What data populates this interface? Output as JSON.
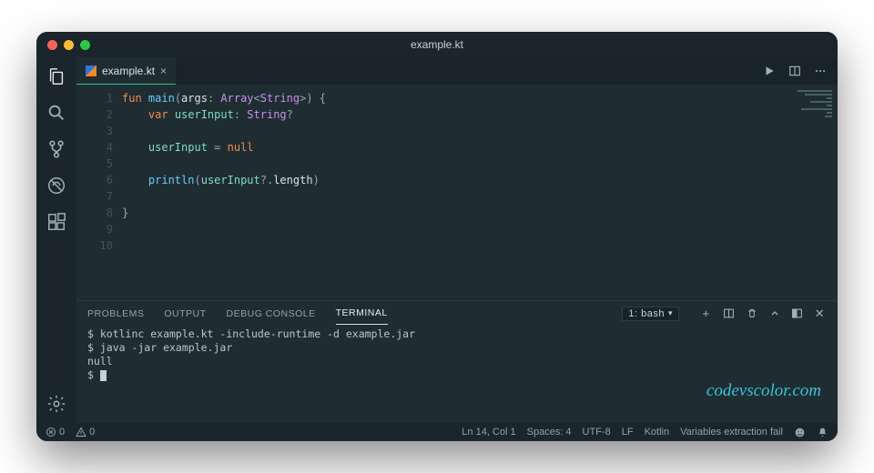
{
  "window": {
    "title": "example.kt"
  },
  "tabs": [
    {
      "label": "example.kt"
    }
  ],
  "editor": {
    "lines": [
      {
        "n": 1,
        "segs": [
          [
            "kw",
            "fun "
          ],
          [
            "fn",
            "main"
          ],
          [
            "punc",
            "("
          ],
          [
            "id",
            "args"
          ],
          [
            "punc",
            ": "
          ],
          [
            "type",
            "Array"
          ],
          [
            "punc",
            "<"
          ],
          [
            "type",
            "String"
          ],
          [
            "punc",
            ">"
          ],
          [
            "punc",
            ") {"
          ]
        ]
      },
      {
        "n": 2,
        "segs": [
          [
            "",
            "    "
          ],
          [
            "kw",
            "var "
          ],
          [
            "var",
            "userInput"
          ],
          [
            "punc",
            ": "
          ],
          [
            "type",
            "String"
          ],
          [
            "punc",
            "?"
          ]
        ]
      },
      {
        "n": 3,
        "segs": [
          [
            "",
            ""
          ]
        ]
      },
      {
        "n": 4,
        "segs": [
          [
            "",
            "    "
          ],
          [
            "var",
            "userInput"
          ],
          [
            "punc",
            " = "
          ],
          [
            "null",
            "null"
          ]
        ]
      },
      {
        "n": 5,
        "segs": [
          [
            "",
            ""
          ]
        ]
      },
      {
        "n": 6,
        "segs": [
          [
            "",
            "    "
          ],
          [
            "fn",
            "println"
          ],
          [
            "punc",
            "("
          ],
          [
            "var",
            "userInput"
          ],
          [
            "punc",
            "?."
          ],
          [
            "id",
            "length"
          ],
          [
            "punc",
            ")"
          ]
        ]
      },
      {
        "n": 7,
        "segs": [
          [
            "",
            ""
          ]
        ]
      },
      {
        "n": 8,
        "segs": [
          [
            "punc",
            "}"
          ]
        ]
      },
      {
        "n": 9,
        "segs": [
          [
            "",
            ""
          ]
        ]
      },
      {
        "n": 10,
        "segs": [
          [
            "",
            ""
          ]
        ]
      }
    ]
  },
  "panel": {
    "tabs": [
      "PROBLEMS",
      "OUTPUT",
      "DEBUG CONSOLE",
      "TERMINAL"
    ],
    "active_tab": 3,
    "terminal_select": "1: bash",
    "terminal_lines": [
      "$ kotlinc example.kt -include-runtime -d example.jar",
      "$ java -jar example.jar",
      "null",
      "$ "
    ]
  },
  "statusbar": {
    "errors": "0",
    "warnings": "0",
    "cursor": "Ln 14, Col 1",
    "indent": "Spaces: 4",
    "encoding": "UTF-8",
    "eol": "LF",
    "lang": "Kotlin",
    "extra": "Variables extraction fail"
  },
  "watermark": "codevscolor.com"
}
